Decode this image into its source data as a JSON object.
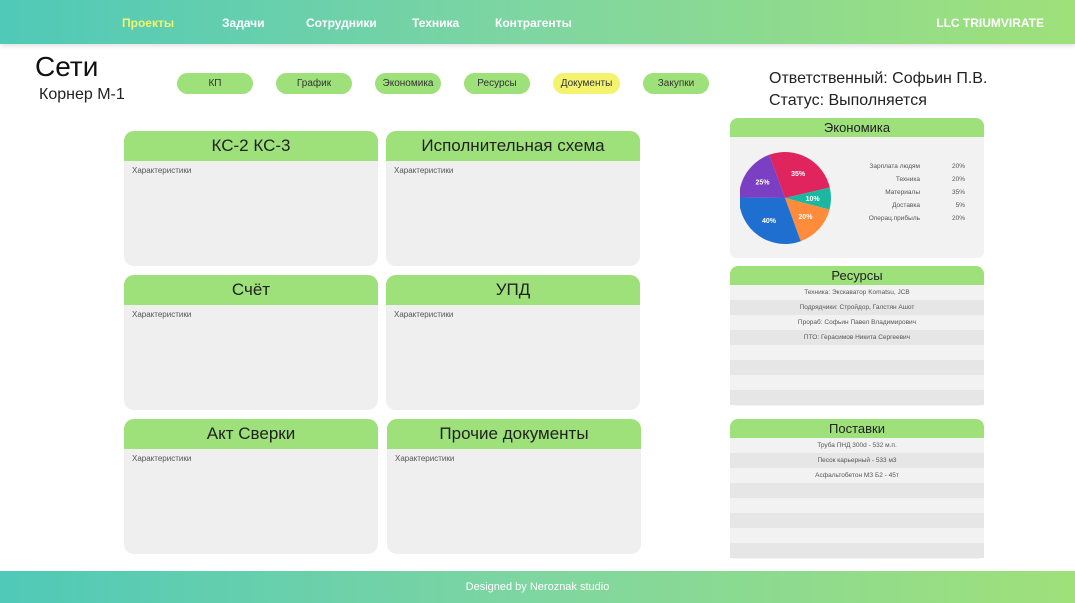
{
  "nav": {
    "items": [
      {
        "label": "Проекты",
        "active": true
      },
      {
        "label": "Задачи",
        "active": false
      },
      {
        "label": "Сотрудники",
        "active": false
      },
      {
        "label": "Техника",
        "active": false
      },
      {
        "label": "Контрагенты",
        "active": false
      }
    ],
    "company": "LLC TRIUMVIRATE"
  },
  "page": {
    "title": "Сети",
    "subtitle": "Корнер М-1"
  },
  "tabs": [
    {
      "label": "КП",
      "active": false
    },
    {
      "label": "График",
      "active": false
    },
    {
      "label": "Экономика",
      "active": false
    },
    {
      "label": "Ресурсы",
      "active": false
    },
    {
      "label": "Документы",
      "active": true
    },
    {
      "label": "Закупки",
      "active": false
    }
  ],
  "info": {
    "responsible": "Ответственный: Софьин П.В.",
    "status": "Статус: Выполняется"
  },
  "documents": [
    {
      "title": "КС-2  КС-3",
      "body": "Характеристики"
    },
    {
      "title": "Исполнительная схема",
      "body": "Характеристики"
    },
    {
      "title": "Счёт",
      "body": "Характеристики"
    },
    {
      "title": "УПД",
      "body": "Характеристики"
    },
    {
      "title": "Акт Сверки",
      "body": "Характеристики"
    },
    {
      "title": "Прочие документы",
      "body": "Характеристики"
    }
  ],
  "economy": {
    "title": "Экономика",
    "legend": [
      {
        "label": "Зарплата людям",
        "value": "20%"
      },
      {
        "label": "Техника",
        "value": "20%"
      },
      {
        "label": "Материалы",
        "value": "35%"
      },
      {
        "label": "Доставка",
        "value": "5%"
      },
      {
        "label": "Операц.прибыль",
        "value": "20%"
      }
    ]
  },
  "chart_data": {
    "type": "pie",
    "slices": [
      {
        "label": "35%",
        "value": 35,
        "color": "#e0245e"
      },
      {
        "label": "10%",
        "value": 10,
        "color": "#1bb89f"
      },
      {
        "label": "20%",
        "value": 20,
        "color": "#ff8c3a"
      },
      {
        "label": "40%",
        "value": 40,
        "color": "#1f6fd0"
      },
      {
        "label": "25%",
        "value": 25,
        "color": "#7a3fc2"
      }
    ]
  },
  "resources": {
    "title": "Ресурсы",
    "rows": [
      "Техника: Экскаватор Komatsu, JCB",
      "Подрядчики: Стройдор, Галстян Ашот",
      "Прораб: Софьин Павел Владимирович",
      "ПТО: Герасимов Никита Сергеевич",
      "",
      "",
      "",
      ""
    ]
  },
  "supplies": {
    "title": "Поставки",
    "rows": [
      "Труба ПНД 300d - 532 м.п.",
      "Песок карьерный - 533 м3",
      "Асфальтобетон МЗ Б2 - 45т",
      "",
      "",
      "",
      "",
      ""
    ]
  },
  "footer": {
    "text": "Designed by Neroznak studio"
  }
}
